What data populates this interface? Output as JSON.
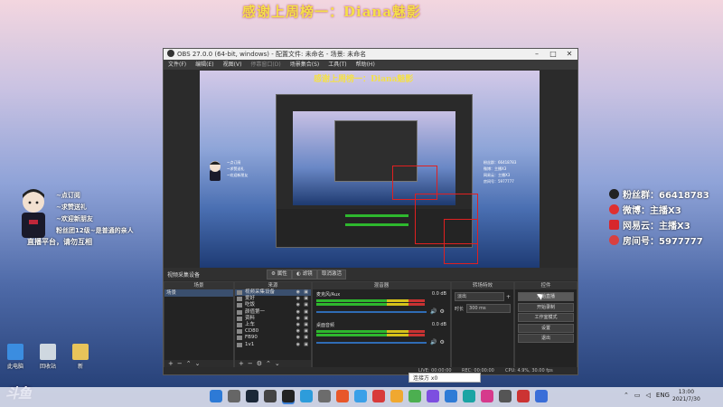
{
  "overlay": {
    "banner": "感谢上周榜一：Diana魅影",
    "right_info": [
      {
        "icon": "qq-icon",
        "color": "#222",
        "text": "粉丝群：66418783"
      },
      {
        "icon": "weibo-icon",
        "color": "#e03030",
        "text": "微博：主播X3"
      },
      {
        "icon": "netease-icon",
        "color": "#d8262c",
        "text": "网易云：主播X3"
      },
      {
        "icon": "room-icon",
        "color": "#d84040",
        "text": "房间号：5977777"
      }
    ],
    "left_info": [
      "~点订阅",
      "~求赞送礼",
      "~欢迎新朋友",
      "粉丝团12级~是普通的亲人",
      "直播平台，请勿互相"
    ],
    "streamer_caption": "直播平台，请勿互相",
    "desktop_icons": [
      {
        "label": "此电脑",
        "color": "#3b8de0"
      },
      {
        "label": "回收站",
        "color": "#cfd8e0"
      },
      {
        "label": "新",
        "color": "#e8c45a"
      }
    ],
    "douyu_logo": "斗鱼"
  },
  "taskbar": {
    "icons": [
      {
        "name": "windows-start-icon",
        "color": "#2d7ad6"
      },
      {
        "name": "search-icon",
        "color": "#666"
      },
      {
        "name": "steam-icon",
        "color": "#1b2838"
      },
      {
        "name": "app-icon",
        "color": "#444"
      },
      {
        "name": "obs-icon",
        "color": "#222"
      },
      {
        "name": "app-icon",
        "color": "#2d9cdb"
      },
      {
        "name": "app-icon",
        "color": "#6c6c6c"
      },
      {
        "name": "app-icon",
        "color": "#e8572a"
      },
      {
        "name": "qq-icon",
        "color": "#3aa0e8"
      },
      {
        "name": "app-icon",
        "color": "#d83a3a"
      },
      {
        "name": "app-icon",
        "color": "#f0a830"
      },
      {
        "name": "app-icon",
        "color": "#4caf50"
      },
      {
        "name": "app-icon",
        "color": "#7d4ee0"
      },
      {
        "name": "app-icon",
        "color": "#2e7bd6"
      },
      {
        "name": "app-icon",
        "color": "#1aa4a4"
      },
      {
        "name": "app-icon",
        "color": "#d63a8c"
      },
      {
        "name": "app-icon",
        "color": "#555"
      },
      {
        "name": "app-icon",
        "color": "#c33"
      },
      {
        "name": "app-icon",
        "color": "#3a6ed8"
      }
    ],
    "tray_lang": "ENG",
    "time": "13:00",
    "date": "2021/7/30"
  },
  "obs": {
    "title": "OBS 27.0.0 (64-bit, windows) - 配置文件: 未命名 - 场景: 未命名",
    "menu": [
      "文件(F)",
      "编辑(E)",
      "视图(V)",
      "停靠窗口(D)",
      "场景集合(S)",
      "工具(T)",
      "帮助(H)"
    ],
    "preview_banner": "感谢上周榜一：Diana魅影",
    "source_bar": {
      "current": "视频采集设备",
      "props": "属性",
      "filters": "滤镜",
      "deactivate": "取消激活"
    },
    "docks": {
      "scenes": {
        "title": "场景",
        "items": [
          "场景"
        ]
      },
      "sources": {
        "title": "来源",
        "items": [
          "视频采集设备",
          "爱好",
          "吃饭",
          "颜值第一",
          "资料",
          "上车",
          "CD80",
          "FB90",
          "1v1"
        ]
      },
      "mixer": {
        "title": "混音器",
        "channels": [
          {
            "name": "麦克风/Aux",
            "db": "0.0 dB"
          },
          {
            "name": "桌面音频",
            "db": "0.0 dB"
          }
        ]
      },
      "transitions": {
        "title": "转场特效",
        "type": "淡出",
        "duration_label": "时长",
        "duration": "300 ms"
      },
      "controls": {
        "title": "控件",
        "buttons": [
          "开始直播",
          "开始录制",
          "工作室模式",
          "设置",
          "退出"
        ]
      }
    },
    "status": {
      "live": "LIVE: 00:00:00",
      "rec": "REC: 00:00:00",
      "cpu": "CPU: 4.9%, 30.00 fps"
    }
  },
  "input_popup": "连接方 x0"
}
